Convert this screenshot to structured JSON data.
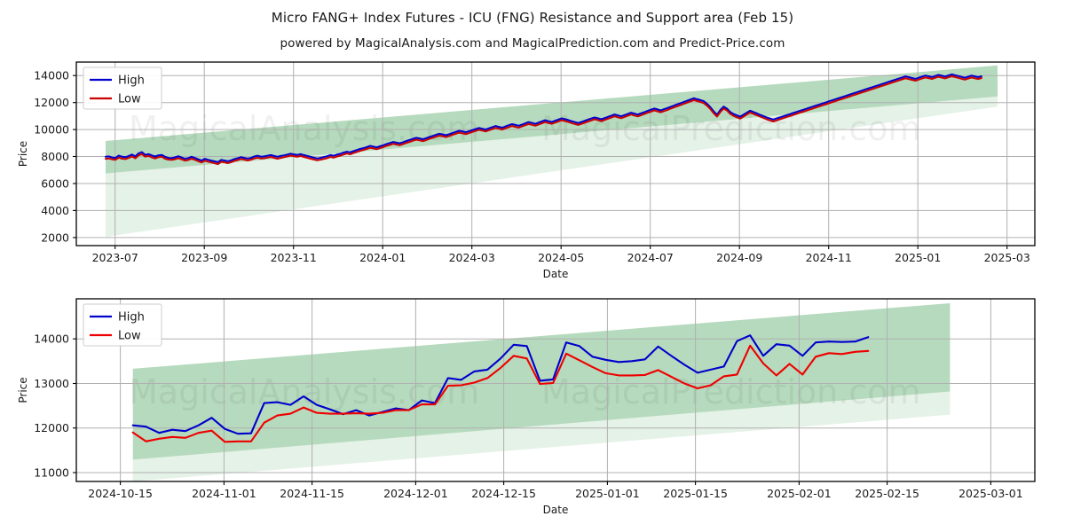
{
  "header": {
    "title": "Micro FANG+ Index Futures - ICU (FNG) Resistance and Support area (Feb 15)",
    "subtitle": "powered by MagicalAnalysis.com and MagicalPrediction.com and Predict-Price.com"
  },
  "watermarks": {
    "row1_left": "MagicalAnalysis.com",
    "row1_right": "MagicalPrediction.com",
    "row2_left": "MagicalAnalysis.com",
    "row2_right": "MagicalPrediction.com"
  },
  "colors": {
    "high": "#0000cc",
    "low": "#cc0000",
    "high_lower": "#0000cc",
    "low_lower": "#ee0000",
    "band_inner": "#8fc79a",
    "band_outer": "#cfe7d3",
    "grid": "#b0b0b0",
    "axis": "#000000",
    "background": "#ffffff"
  },
  "chart_data": [
    {
      "type": "line",
      "id": "upper-chart",
      "title": "Micro FANG+ Index Futures - ICU (FNG) Resistance and Support area (Feb 15)",
      "xlabel": "Date",
      "ylabel": "Price",
      "grid": true,
      "legend_position": "upper left",
      "xlim": [
        "2023-06-05",
        "2025-03-20"
      ],
      "ylim": [
        1400,
        15000
      ],
      "yticks": [
        2000,
        4000,
        6000,
        8000,
        10000,
        12000,
        14000
      ],
      "ytick_labels": [
        "2000",
        "4000",
        "6000",
        "8000",
        "10000",
        "12000",
        "14000"
      ],
      "xticks": [
        "2023-07",
        "2023-09",
        "2023-11",
        "2024-01",
        "2024-03",
        "2024-05",
        "2024-07",
        "2024-09",
        "2024-11",
        "2025-01",
        "2025-03"
      ],
      "xtick_labels": [
        "2023-07",
        "2023-09",
        "2023-11",
        "2024-01",
        "2024-03",
        "2024-05",
        "2024-07",
        "2024-09",
        "2024-11",
        "2025-01",
        "2025-03"
      ],
      "series": [
        {
          "name": "High",
          "color": "#0000cc",
          "values": [
            7980,
            8010,
            7930,
            7900,
            8070,
            7980,
            7950,
            8040,
            8150,
            8010,
            8240,
            8330,
            8130,
            8180,
            8080,
            8000,
            8090,
            8120,
            7980,
            7900,
            7880,
            7940,
            8020,
            7930,
            7840,
            7880,
            7980,
            7900,
            7800,
            7700,
            7830,
            7760,
            7700,
            7640,
            7580,
            7750,
            7700,
            7650,
            7720,
            7820,
            7880,
            7960,
            7900,
            7850,
            7900,
            8000,
            8060,
            7990,
            8010,
            8060,
            8110,
            8040,
            7980,
            8040,
            8090,
            8150,
            8210,
            8160,
            8120,
            8180,
            8110,
            8050,
            7980,
            7920,
            7860,
            7900,
            7960,
            8020,
            8110,
            8060,
            8140,
            8200,
            8290,
            8360,
            8310,
            8400,
            8480,
            8560,
            8620,
            8700,
            8790,
            8740,
            8680,
            8760,
            8840,
            8930,
            9000,
            9080,
            9030,
            8980,
            9060,
            9150,
            9230,
            9310,
            9390,
            9340,
            9280,
            9360,
            9450,
            9530,
            9610,
            9690,
            9640,
            9580,
            9660,
            9750,
            9830,
            9910,
            9860,
            9800,
            9880,
            9960,
            10040,
            10120,
            10060,
            10000,
            10090,
            10180,
            10260,
            10200,
            10140,
            10230,
            10320,
            10400,
            10340,
            10280,
            10370,
            10460,
            10550,
            10490,
            10420,
            10510,
            10600,
            10690,
            10620,
            10560,
            10650,
            10740,
            10830,
            10770,
            10700,
            10620,
            10550,
            10480,
            10560,
            10650,
            10740,
            10820,
            10900,
            10830,
            10760,
            10850,
            10940,
            11030,
            11120,
            11050,
            10980,
            11070,
            11160,
            11250,
            11180,
            11110,
            11200,
            11290,
            11380,
            11470,
            11560,
            11490,
            11420,
            11510,
            11600,
            11690,
            11780,
            11870,
            11960,
            12050,
            12140,
            12230,
            12320,
            12250,
            12180,
            12100,
            11900,
            11650,
            11350,
            11100,
            11450,
            11700,
            11550,
            11300,
            11150,
            11050,
            10950,
            11100,
            11250,
            11400,
            11300,
            11200,
            11100,
            11000,
            10900,
            10820,
            10740,
            10820,
            10900,
            10980,
            11060,
            11140,
            11220,
            11300,
            11380,
            11460,
            11540,
            11620,
            11700,
            11780,
            11860,
            11940,
            12020,
            12100,
            12180,
            12260,
            12340,
            12420,
            12500,
            12580,
            12660,
            12740,
            12820,
            12900,
            12980,
            13060,
            13140,
            13220,
            13300,
            13380,
            13460,
            13540,
            13620,
            13700,
            13780,
            13860,
            13940,
            13880,
            13820,
            13760,
            13840,
            13920,
            14000,
            13950,
            13890,
            13970,
            14050,
            13990,
            13930,
            14010,
            14090,
            14030,
            13970,
            13900,
            13840,
            13920,
            14000,
            13940,
            13880,
            13950
          ]
        },
        {
          "name": "Low",
          "color": "#cc0000",
          "values": [
            7830,
            7860,
            7790,
            7760,
            7920,
            7840,
            7810,
            7900,
            8000,
            7870,
            8090,
            8180,
            7990,
            8040,
            7940,
            7860,
            7950,
            7980,
            7840,
            7770,
            7750,
            7800,
            7880,
            7790,
            7700,
            7740,
            7840,
            7760,
            7660,
            7560,
            7690,
            7620,
            7560,
            7500,
            7440,
            7610,
            7560,
            7510,
            7580,
            7680,
            7740,
            7820,
            7760,
            7710,
            7760,
            7860,
            7920,
            7850,
            7870,
            7920,
            7970,
            7900,
            7840,
            7900,
            7950,
            8010,
            8070,
            8020,
            7980,
            8040,
            7970,
            7910,
            7840,
            7780,
            7720,
            7760,
            7820,
            7880,
            7970,
            7920,
            8000,
            8060,
            8150,
            8220,
            8170,
            8260,
            8340,
            8420,
            8480,
            8560,
            8650,
            8600,
            8540,
            8620,
            8700,
            8790,
            8860,
            8940,
            8890,
            8840,
            8920,
            9010,
            9090,
            9170,
            9250,
            9200,
            9140,
            9220,
            9310,
            9390,
            9470,
            9550,
            9500,
            9440,
            9520,
            9610,
            9690,
            9770,
            9720,
            9660,
            9740,
            9820,
            9900,
            9980,
            9920,
            9860,
            9950,
            10040,
            10120,
            10060,
            10000,
            10090,
            10180,
            10260,
            10200,
            10140,
            10230,
            10320,
            10410,
            10350,
            10280,
            10370,
            10460,
            10550,
            10480,
            10420,
            10510,
            10600,
            10690,
            10630,
            10560,
            10480,
            10410,
            10340,
            10420,
            10510,
            10600,
            10680,
            10760,
            10690,
            10620,
            10710,
            10800,
            10890,
            10980,
            10910,
            10840,
            10930,
            11020,
            11110,
            11040,
            10970,
            11060,
            11150,
            11240,
            11330,
            11420,
            11350,
            11280,
            11370,
            11460,
            11550,
            11640,
            11730,
            11820,
            11910,
            12000,
            12090,
            12180,
            12110,
            12040,
            11960,
            11760,
            11510,
            11210,
            10960,
            11310,
            11560,
            11410,
            11160,
            11010,
            10910,
            10810,
            10960,
            11110,
            11260,
            11160,
            11060,
            10960,
            10860,
            10760,
            10680,
            10600,
            10680,
            10760,
            10840,
            10920,
            11000,
            11080,
            11160,
            11240,
            11320,
            11400,
            11480,
            11560,
            11640,
            11720,
            11800,
            11880,
            11960,
            12040,
            12120,
            12200,
            12280,
            12360,
            12440,
            12520,
            12600,
            12680,
            12760,
            12840,
            12920,
            13000,
            13080,
            13160,
            13240,
            13320,
            13400,
            13480,
            13560,
            13640,
            13720,
            13800,
            13740,
            13680,
            13620,
            13700,
            13780,
            13860,
            13810,
            13750,
            13830,
            13910,
            13850,
            13790,
            13870,
            13950,
            13890,
            13830,
            13760,
            13700,
            13780,
            13860,
            13800,
            13740,
            13820
          ]
        }
      ],
      "bands": {
        "inner": {
          "label": "resistance-support-inner-band",
          "color": "#8fc79a",
          "opacity": 0.55,
          "start_date": "2023-06-25",
          "end_date": "2025-02-25",
          "start_upper": 9150,
          "start_lower": 6750,
          "end_upper": 14750,
          "end_lower": 12450
        },
        "outer": {
          "label": "resistance-support-outer-band",
          "color": "#cfe7d3",
          "opacity": 0.55,
          "start_date": "2023-06-25",
          "end_date": "2025-02-25",
          "start_upper": 9150,
          "start_lower": 2050,
          "end_upper": 14750,
          "end_lower": 11700
        }
      }
    },
    {
      "type": "line",
      "id": "lower-chart",
      "title": "Zoomed recent range",
      "xlabel": "Date",
      "ylabel": "Price",
      "grid": true,
      "legend_position": "upper left",
      "xlim": [
        "2024-10-08",
        "2025-03-08"
      ],
      "ylim": [
        10800,
        14900
      ],
      "yticks": [
        11000,
        12000,
        13000,
        14000
      ],
      "ytick_labels": [
        "11000",
        "12000",
        "13000",
        "14000"
      ],
      "xticks": [
        "2024-10-15",
        "2024-11-01",
        "2024-11-15",
        "2024-12-01",
        "2024-12-15",
        "2025-01-01",
        "2025-01-15",
        "2025-02-01",
        "2025-02-15",
        "2025-03-01"
      ],
      "xtick_labels": [
        "2024-10-15",
        "2024-11-01",
        "2024-11-15",
        "2024-12-01",
        "2024-12-15",
        "2025-01-01",
        "2025-01-15",
        "2025-02-01",
        "2025-02-15",
        "2025-03-01"
      ],
      "series": [
        {
          "name": "High",
          "color": "#0000cc",
          "values": [
            12060,
            12030,
            11890,
            11960,
            11930,
            12060,
            12230,
            11980,
            11870,
            11880,
            12560,
            12580,
            12520,
            12710,
            12520,
            12420,
            12310,
            12400,
            12280,
            12360,
            12440,
            12400,
            12620,
            12560,
            13120,
            13080,
            13270,
            13310,
            13560,
            13870,
            13840,
            13060,
            13090,
            13920,
            13840,
            13600,
            13530,
            13480,
            13500,
            13540,
            13830,
            13620,
            13420,
            13240,
            13310,
            13380,
            13950,
            14080,
            13620,
            13880,
            13850,
            13620,
            13920,
            13940,
            13930,
            13940,
            14040
          ]
        },
        {
          "name": "Low",
          "color": "#ee0000",
          "values": [
            11900,
            11700,
            11760,
            11800,
            11780,
            11890,
            11940,
            11690,
            11700,
            11700,
            12120,
            12280,
            12320,
            12460,
            12340,
            12320,
            12320,
            12330,
            12320,
            12340,
            12400,
            12400,
            12530,
            12530,
            12950,
            12960,
            13020,
            13120,
            13350,
            13620,
            13560,
            12990,
            13010,
            13670,
            13520,
            13370,
            13230,
            13180,
            13180,
            13190,
            13300,
            13150,
            13000,
            12890,
            12960,
            13160,
            13200,
            13850,
            13450,
            13180,
            13440,
            13200,
            13600,
            13680,
            13660,
            13710,
            13730
          ]
        }
      ],
      "bands": {
        "inner": {
          "label": "resistance-support-inner-band",
          "color": "#8fc79a",
          "opacity": 0.55,
          "start_date": "2024-10-17",
          "end_date": "2025-02-25",
          "start_upper": 13330,
          "start_lower": 11290,
          "end_upper": 14800,
          "end_lower": 12820
        },
        "outer": {
          "label": "resistance-support-outer-band",
          "color": "#cfe7d3",
          "opacity": 0.55,
          "start_date": "2024-10-17",
          "end_date": "2025-02-25",
          "start_upper": 13330,
          "start_lower": 10800,
          "end_upper": 14800,
          "end_lower": 12300
        }
      }
    }
  ]
}
